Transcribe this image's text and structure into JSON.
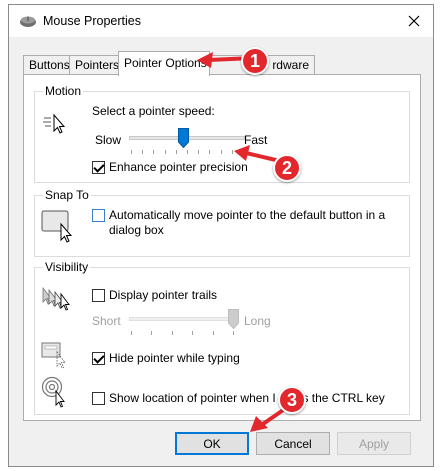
{
  "window": {
    "title": "Mouse Properties"
  },
  "tabs": [
    {
      "label": "Buttons"
    },
    {
      "label": "Pointers"
    },
    {
      "label": "Pointer Options",
      "active": true
    },
    {
      "label": "rdware"
    }
  ],
  "motion": {
    "label": "Motion",
    "speed_label": "Select a pointer speed:",
    "slow": "Slow",
    "fast": "Fast",
    "speed_fraction": 0.47,
    "enhance_label": "Enhance pointer precision",
    "enhance_checked": true
  },
  "snap": {
    "label": "Snap To",
    "text_line1": "Automatically move pointer to the default button in a",
    "text_line2": "dialog box",
    "checked": false
  },
  "visibility": {
    "label": "Visibility",
    "trails_label": "Display pointer trails",
    "trails_checked": false,
    "short": "Short",
    "long": "Long",
    "trail_fraction": 1.0,
    "hide_label": "Hide pointer while typing",
    "hide_checked": true,
    "ctrl_label": "Show location of pointer when I press the CTRL key",
    "ctrl_checked": false
  },
  "buttons": {
    "ok": "OK",
    "cancel": "Cancel",
    "apply": "Apply"
  },
  "annotations": [
    "1",
    "2",
    "3"
  ],
  "colors": {
    "accent": "#0078d7",
    "callout": "#e2272d"
  }
}
